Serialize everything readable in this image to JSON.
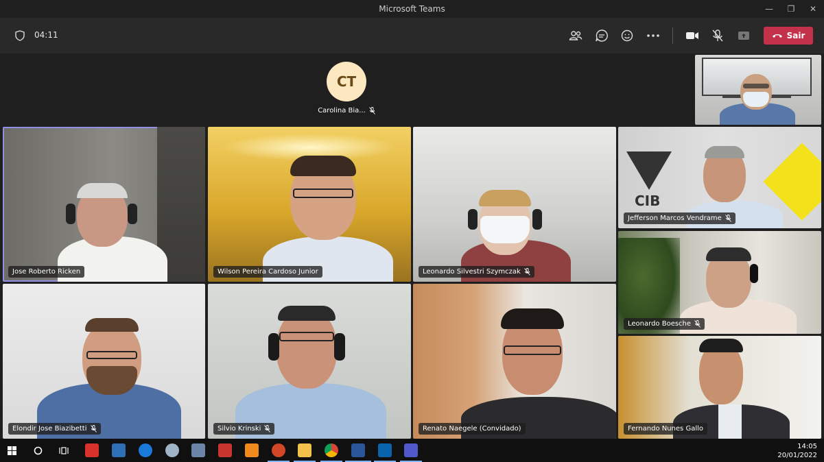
{
  "window": {
    "title": "Microsoft Teams"
  },
  "toolbar": {
    "timer": "04:11",
    "leave_label": "Sair"
  },
  "featured": {
    "initials": "CT",
    "name": "Carolina Bia..."
  },
  "participants": [
    {
      "name": "Jose Roberto Ricken",
      "muted": false
    },
    {
      "name": "Wilson Pereira Cardoso Junior",
      "muted": false
    },
    {
      "name": "Leonardo Silvestri Szymczak",
      "muted": true
    },
    {
      "name": "Jefferson Marcos Vendrame",
      "muted": true
    },
    {
      "name": "Leonardo Boesche",
      "muted": true
    },
    {
      "name": "Elondir Jose Biazibetti",
      "muted": true
    },
    {
      "name": "Silvio Krinski",
      "muted": true
    },
    {
      "name": "Renato Naegele (Convidado)",
      "muted": false
    },
    {
      "name": "Fernando Nunes Gallo",
      "muted": false
    }
  ],
  "backgrounds": {
    "cib_text": "CIB"
  },
  "clock": {
    "time": "14:05",
    "date": "20/01/2022"
  },
  "colors": {
    "leave": "#c4314b",
    "selected": "#8f8fe8",
    "avatar_bg": "#fbe7c0"
  }
}
